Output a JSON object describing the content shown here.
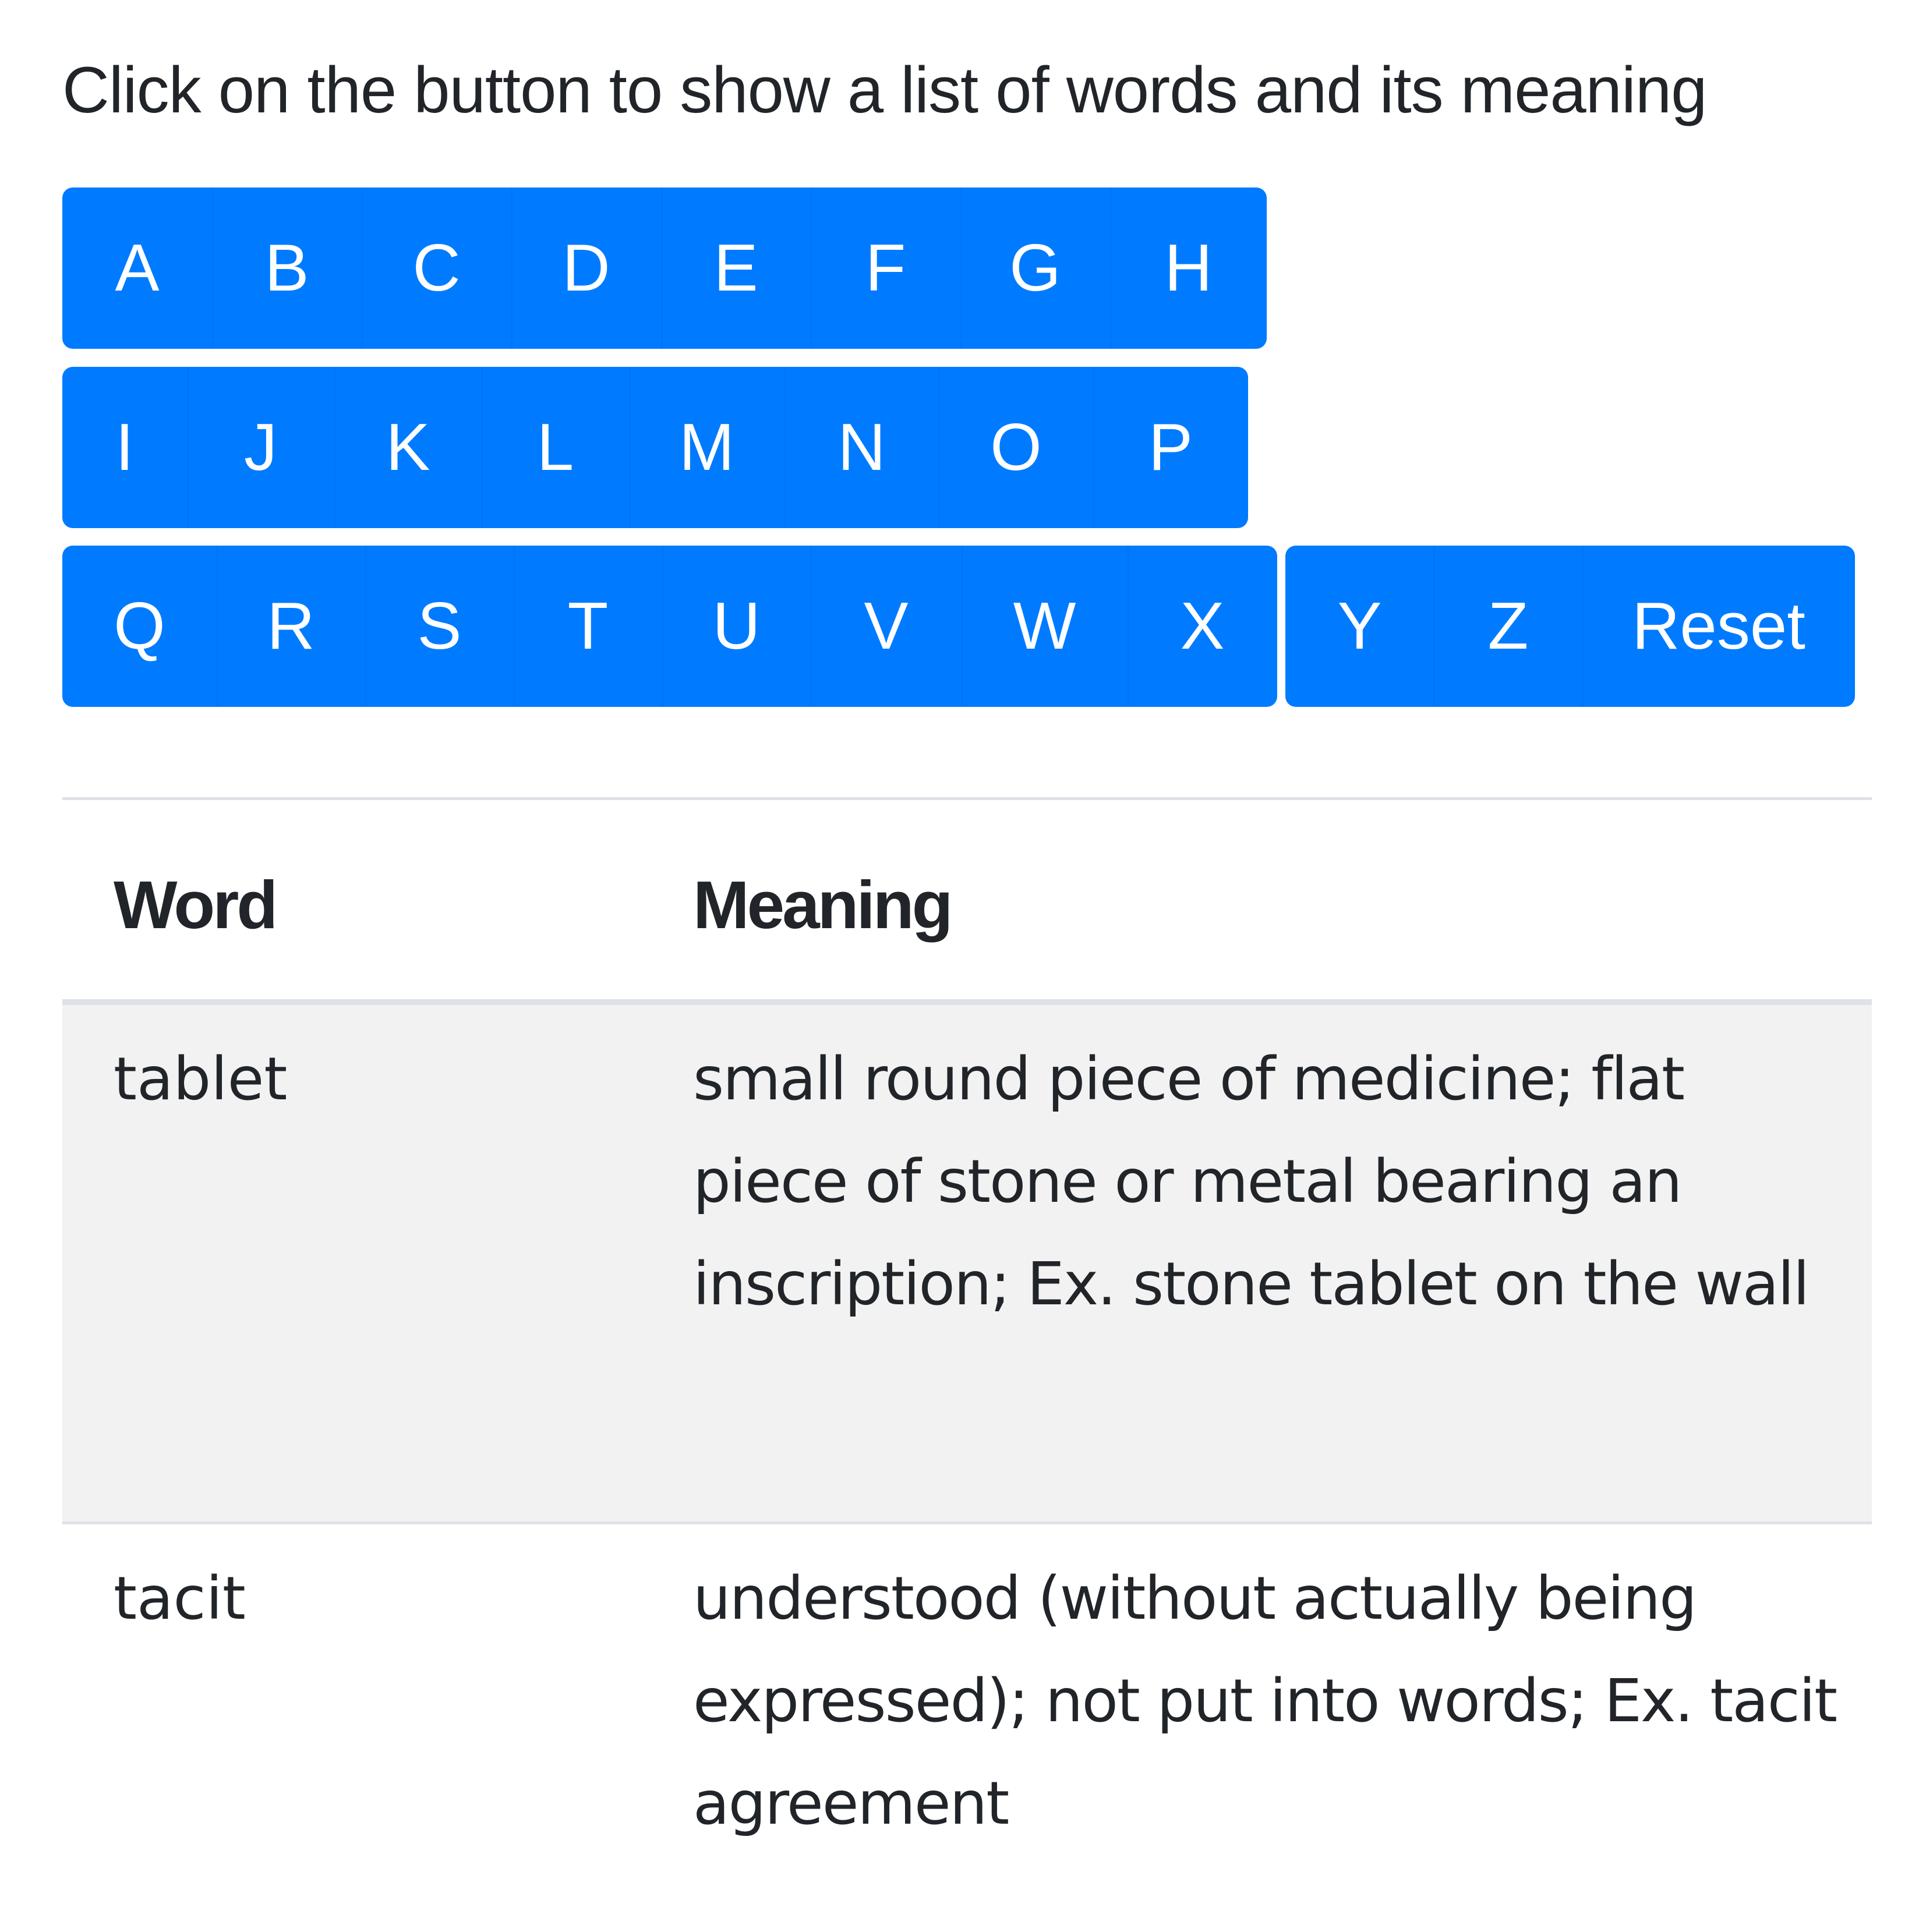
{
  "heading": "Click on the button to show a list of words and its meaning",
  "colors": {
    "button_bg": "#007bff",
    "button_text": "#ffffff",
    "striped_row_bg": "#f2f2f2",
    "border": "#dee2e6",
    "text": "#212529"
  },
  "letter_buttons": {
    "row1": [
      "A",
      "B",
      "C",
      "D",
      "E",
      "F",
      "G",
      "H"
    ],
    "row2": [
      "I",
      "J",
      "K",
      "L",
      "M",
      "N",
      "O",
      "P"
    ],
    "row3": [
      "Q",
      "R",
      "S",
      "T",
      "U",
      "V",
      "W",
      "X"
    ],
    "row4": [
      "Y",
      "Z"
    ]
  },
  "reset_label": "Reset",
  "table": {
    "headers": [
      "Word",
      "Meaning"
    ],
    "rows": [
      {
        "word": "tablet",
        "meaning": "small round piece of medicine; flat piece of stone or metal bearing an inscription; Ex. stone tablet on the wall"
      },
      {
        "word": "tacit",
        "meaning": "understood (without actually being expressed); not put into words; Ex. tacit agreement"
      }
    ]
  }
}
